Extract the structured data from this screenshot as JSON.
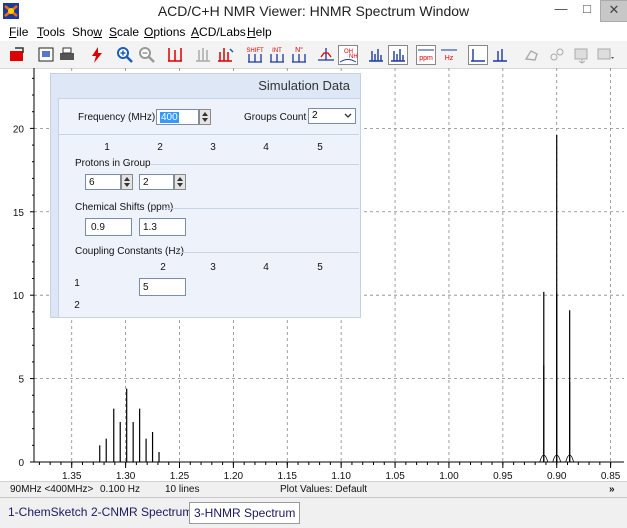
{
  "window": {
    "title": "ACD/C+H NMR Viewer: HNMR Spectrum Window"
  },
  "menu": [
    "File",
    "Tools",
    "Show",
    "Scale",
    "Options",
    "ACD/Labs",
    "Help"
  ],
  "toolbar_icons": [
    "open-icon",
    "image-icon",
    "print-icon",
    "lightning-icon",
    "zoom-in-icon",
    "zoom-out-icon",
    "peak-icon",
    "peak-split-icon",
    "peak-multiplet-icon",
    "shift-icon",
    "integration-icon",
    "n-label-icon",
    "peak-pick-icon",
    "oh-nh-icon",
    "spectrum-icon",
    "spectrum-overlay-icon",
    "ppm-scale-icon",
    "hz-scale-icon",
    "baseline-icon",
    "baseline-correct-icon",
    "molecule-icon",
    "molecule-link-icon",
    "export-icon"
  ],
  "toolbar_labels": {
    "shift": "SHIFT",
    "int": "INT",
    "n": "N°",
    "oh": "OH",
    "nh": "NH",
    "ppm": "ppm",
    "hz": "Hz"
  },
  "chart_data": {
    "type": "line",
    "xlim": [
      1.385,
      0.845
    ],
    "ylim": [
      0,
      23.5
    ],
    "x_ticks": [
      1.35,
      1.3,
      1.25,
      1.2,
      1.15,
      1.1,
      1.05,
      1.0,
      0.95,
      0.9,
      0.85
    ],
    "x_tick_labels": [
      "1.35",
      "1.30",
      "1.25",
      "1.20",
      "1.15",
      "1.10",
      "1.05",
      "1.00",
      "0.95",
      "0.90",
      "0.85"
    ],
    "y_ticks": [
      0,
      5,
      10,
      15,
      20
    ],
    "y_tick_labels": [
      "0",
      "5",
      "10",
      "15",
      "20"
    ],
    "grid": true,
    "peaks": [
      {
        "x": 1.324,
        "y": 1.0
      },
      {
        "x": 1.318,
        "y": 1.4
      },
      {
        "x": 1.311,
        "y": 3.2
      },
      {
        "x": 1.305,
        "y": 2.4
      },
      {
        "x": 1.299,
        "y": 4.4
      },
      {
        "x": 1.293,
        "y": 2.4
      },
      {
        "x": 1.287,
        "y": 3.2
      },
      {
        "x": 1.281,
        "y": 1.4
      },
      {
        "x": 1.275,
        "y": 1.8
      },
      {
        "x": 1.269,
        "y": 0.6
      },
      {
        "x": 0.912,
        "y": 10.2
      },
      {
        "x": 0.912,
        "y": 5.8
      },
      {
        "x": 0.9,
        "y": 19.6
      },
      {
        "x": 0.9,
        "y": 10.1
      },
      {
        "x": 0.888,
        "y": 9.1
      },
      {
        "x": 0.888,
        "y": 4.8
      }
    ]
  },
  "simulation": {
    "title": "Simulation Data",
    "frequency_label": "Frequency (MHz) :",
    "frequency_value": "400",
    "groups_count_label": "Groups Count :",
    "groups_count_value": "2",
    "group_numbers": [
      "1",
      "2",
      "3",
      "4",
      "5"
    ],
    "protons_label": "Protons in Group",
    "protons_values": [
      "6",
      "2"
    ],
    "shifts_label": "Chemical Shifts (ppm)",
    "shifts_values": [
      "0.9",
      "1.3"
    ],
    "coupling_label": "Coupling Constants (Hz)",
    "coupling_col_numbers": [
      "2",
      "3",
      "4",
      "5"
    ],
    "coupling_row_numbers": [
      "1",
      "2"
    ],
    "coupling_value": "5"
  },
  "status": {
    "freq": "90MHz <400MHz>",
    "width": "0.100 Hz",
    "lines": "10 lines",
    "plot_values": "Plot Values: Default",
    "more": "»"
  },
  "tabs": [
    "1-ChemSketch",
    "2-CNMR Spectrum",
    "3-HNMR Spectrum"
  ],
  "colors": {
    "accent": "#1a1a60",
    "selection": "#3399ff",
    "toolbar_red": "#d00000"
  }
}
